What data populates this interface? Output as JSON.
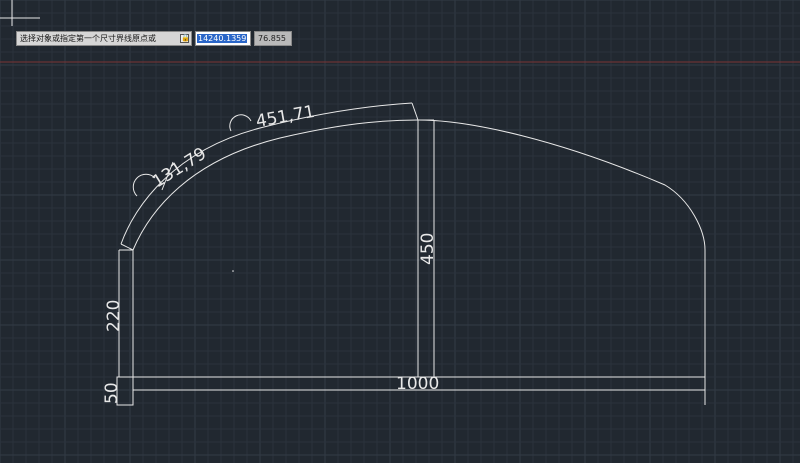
{
  "command_prompt": {
    "text": "选择对象或指定第一个尺寸界线原点或",
    "lock_glyph": "🔒"
  },
  "coord_input": {
    "x_value": "14240.1359",
    "y_value": "76.855"
  },
  "dimensions": {
    "arc_small": "131,79",
    "arc_large": "451,71",
    "height_center": "450",
    "height_left": "220",
    "base_height": "50",
    "base_width": "1000"
  },
  "colors": {
    "background": "#212830",
    "grid_minor": "#2a323c",
    "grid_major": "#323b46",
    "drawing": "#e8e8e8",
    "axis_line": "#7a3434"
  }
}
